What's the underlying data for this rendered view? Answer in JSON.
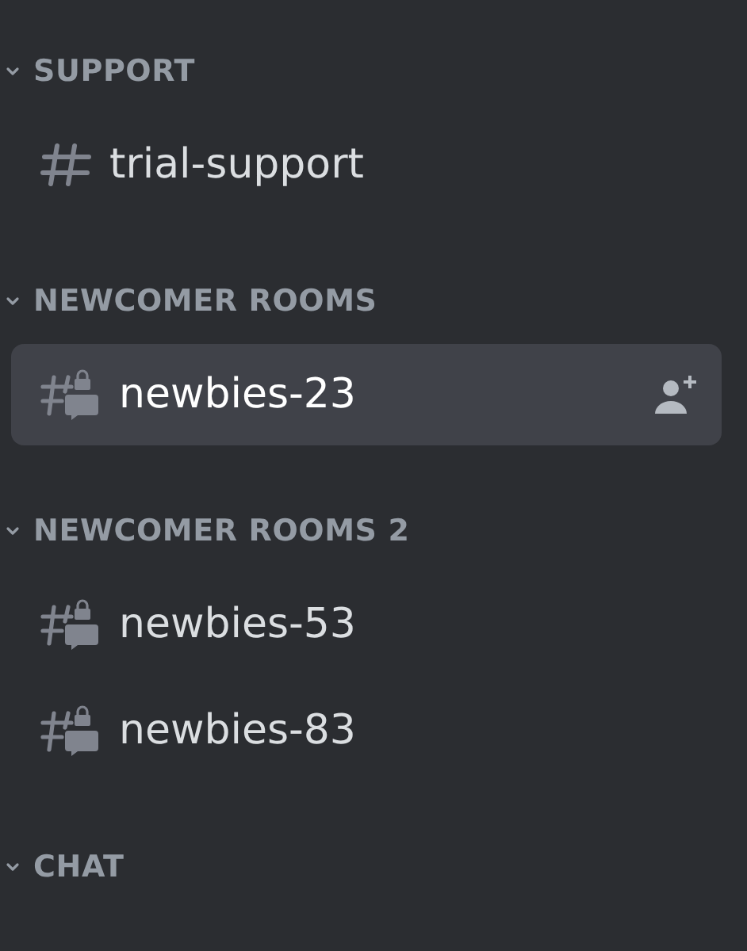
{
  "categories": [
    {
      "name": "SUPPORT",
      "expanded": true,
      "channels": [
        {
          "name": "trial-support",
          "kind": "text",
          "selected": false
        }
      ]
    },
    {
      "name": "NEWCOMER ROOMS",
      "expanded": true,
      "channels": [
        {
          "name": "newbies-23",
          "kind": "private-thread",
          "selected": true
        }
      ]
    },
    {
      "name": "NEWCOMER ROOMS 2",
      "expanded": true,
      "channels": [
        {
          "name": "newbies-53",
          "kind": "private-thread",
          "selected": false
        },
        {
          "name": "newbies-83",
          "kind": "private-thread",
          "selected": false
        }
      ]
    },
    {
      "name": "CHAT",
      "expanded": true
    }
  ]
}
